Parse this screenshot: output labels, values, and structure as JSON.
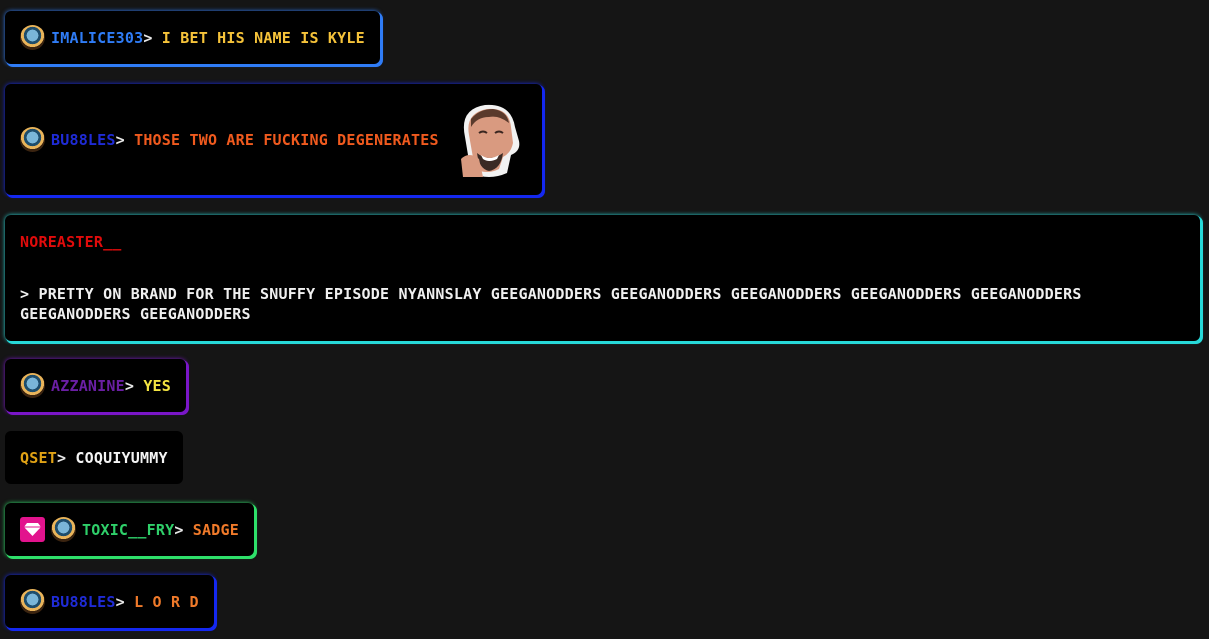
{
  "colors": {
    "background": "#151515",
    "bubble": "#000000"
  },
  "messages": [
    {
      "user": "IMALICE303",
      "sep": ">",
      "text": "I BET HIS NAME IS KYLE",
      "user_color": "#2f7cf6",
      "text_color": "#f6c33a",
      "glow": "#2f7cf6"
    },
    {
      "user": "BU88LES",
      "sep": ">",
      "text": "THOSE TWO ARE FUCKING DEGENERATES",
      "user_color": "#1f2bd6",
      "text_color": "#f05a1e",
      "glow": "#1428f0",
      "emote": "laughing-man-emote"
    },
    {
      "user": "NOREASTER__",
      "sep": ">",
      "text": "PRETTY ON BRAND FOR THE SNUFFY EPISODE NYANNSLAY GEEGANODDERS GEEGANODDERS GEEGANODDERS GEEGANODDERS GEEGANODDERS GEEGANODDERS GEEGANODDERS",
      "user_color": "#e10b0b",
      "text_color": "#f0f0f0",
      "glow": "#27d9d9"
    },
    {
      "user": "AZZANINE",
      "sep": ">",
      "text": "YES",
      "user_color": "#6a1fa3",
      "text_color": "#f4e542",
      "glow": "#7a16c8"
    },
    {
      "user": "QSET",
      "sep": ">",
      "text": "COQUIYUMMY",
      "user_color": "#e0a215",
      "text_color": "#f4f4f4",
      "glow": ""
    },
    {
      "user": "TOXIC__FRY",
      "sep": ">",
      "text": "SADGE",
      "user_color": "#2fd06a",
      "text_color": "#f07a2a",
      "glow": "#2ee06a"
    },
    {
      "user": "BU88LES",
      "sep": ">",
      "text": "L O R D",
      "user_color": "#1f2bd6",
      "text_color": "#f07a2a",
      "glow": "#1428f0"
    }
  ]
}
